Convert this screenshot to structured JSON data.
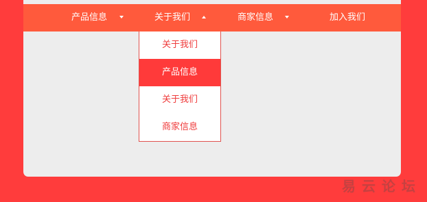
{
  "nav": {
    "items": [
      {
        "label": "产品信息",
        "caret": "down"
      },
      {
        "label": "关于我们",
        "caret": "up"
      },
      {
        "label": "商家信息",
        "caret": "down"
      },
      {
        "label": "加入我们"
      }
    ]
  },
  "dropdown": {
    "items": [
      {
        "label": "关于我们",
        "active": false
      },
      {
        "label": "产品信息",
        "active": true
      },
      {
        "label": "关于我们",
        "active": false
      },
      {
        "label": "商家信息",
        "active": false
      }
    ]
  },
  "watermark": "易云论坛",
  "colors": {
    "background": "#ff3c3c",
    "navbar": "#ff5a3c",
    "panel": "#ededed",
    "dropdown_active": "#ff3a3a",
    "dropdown_text": "#ef3b3b"
  },
  "icons": {
    "down": "caret-down-icon",
    "up": "caret-up-icon"
  }
}
